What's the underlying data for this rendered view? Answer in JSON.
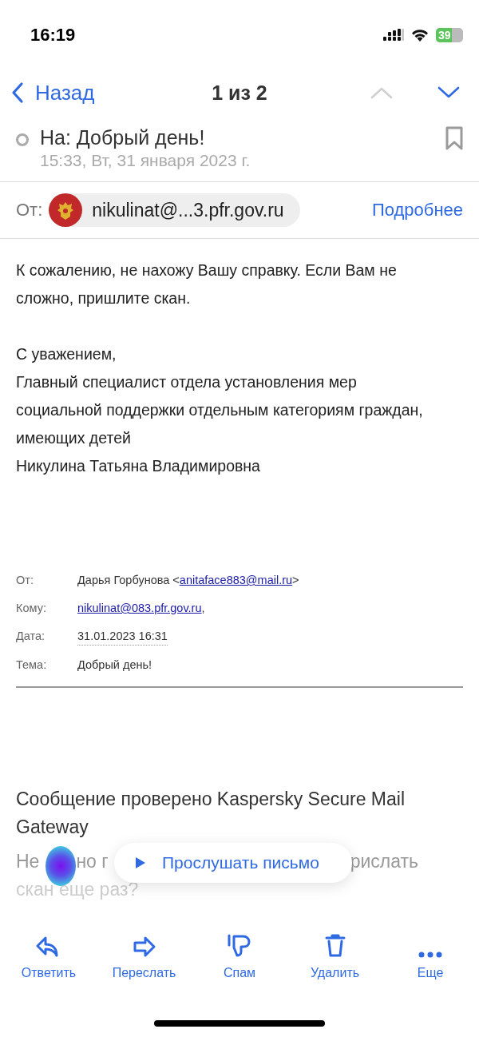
{
  "status_bar": {
    "time": "16:19",
    "battery": "39"
  },
  "nav": {
    "back": "Назад",
    "counter": "1 из 2",
    "prev_disabled": true,
    "next_disabled": false
  },
  "message": {
    "subject": "На: Добрый день!",
    "read": true,
    "bookmarked": false,
    "date": "15:33, Вт, 31 января 2023 г.",
    "from_label": "От:",
    "from": "nikulinat@...3.pfr.gov.ru",
    "details": "Подробнее"
  },
  "body": [
    "К сожалению, не нахожу Вашу справку. Если Вам не сложно, пришлите скан.",
    "С уважением,\nГлавный специалист отдела установления мер социальной поддержки отдельным категориям граждан, имеющих детей\nНикулина Татьяна Владимировна"
  ],
  "quoted_header": [
    {
      "label": "От:",
      "text": "Дарья Горбунова <",
      "link": "anitaface883@mail.ru",
      "after": ">"
    },
    {
      "label": "Кому:",
      "link": "nikulinat@083.pfr.gov.ru",
      "after": ","
    },
    {
      "label": "Дата:",
      "date": "31.01.2023 16:31"
    },
    {
      "label": "Тема:",
      "text": "Добрый день!"
    }
  ],
  "scan_note": "Сообщение проверено Kaspersky Secure Mail Gateway",
  "partial_line": [
    "Не",
    "но г",
    "рислать"
  ],
  "partial_line_2": "скан еще раз?",
  "listen_button": "Прослушать письмо",
  "toolbar": [
    {
      "kind": "reply",
      "label": "Ответить"
    },
    {
      "kind": "forward",
      "label": "Переслать"
    },
    {
      "kind": "spam",
      "label": "Спам"
    },
    {
      "kind": "delete",
      "label": "Удалить"
    },
    {
      "kind": "more",
      "label": "Еще"
    }
  ]
}
